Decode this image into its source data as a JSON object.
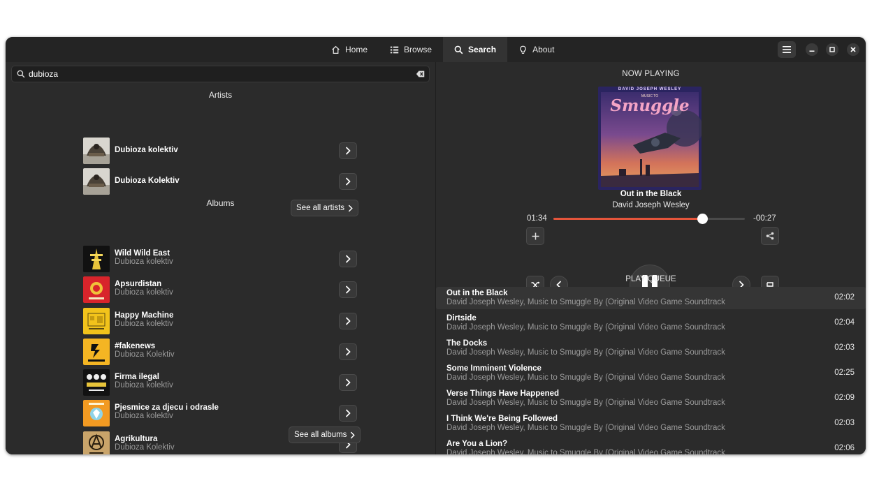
{
  "nav": {
    "tabs": [
      {
        "label": "Home",
        "icon": "home-icon"
      },
      {
        "label": "Browse",
        "icon": "list-icon"
      },
      {
        "label": "Search",
        "icon": "search-icon",
        "active": true
      },
      {
        "label": "About",
        "icon": "lightbulb-icon"
      }
    ]
  },
  "search": {
    "value": "dubioza"
  },
  "artists": {
    "heading": "Artists",
    "items": [
      {
        "name": "Dubioza kolektiv"
      },
      {
        "name": "Dubioza Kolektiv"
      }
    ],
    "see_all": "See all artists"
  },
  "albums": {
    "heading": "Albums",
    "items": [
      {
        "title": "Wild Wild East",
        "artist": "Dubioza kolektiv",
        "color": "#111111"
      },
      {
        "title": "Apsurdistan",
        "artist": "Dubioza kolektiv",
        "color": "#d8242b"
      },
      {
        "title": "Happy Machine",
        "artist": "Dubioza kolektiv",
        "color": "#f2c31b"
      },
      {
        "title": "#fakenews",
        "artist": "Dubioza Kolektiv",
        "color": "#f4b523"
      },
      {
        "title": "Firma ilegal",
        "artist": "Dubioza kolektiv",
        "color": "#121212"
      },
      {
        "title": "Pjesmice za djecu i odrasle",
        "artist": "Dubioza kolektiv",
        "color": "#f29a22"
      },
      {
        "title": "Agrikultura",
        "artist": "Dubioza Kolektiv",
        "color": "#c9a46a"
      }
    ],
    "see_all": "See all albums"
  },
  "now_playing": {
    "heading": "NOW PLAYING",
    "title": "Out in the Black",
    "artist": "David Joseph Wesley",
    "elapsed": "01:34",
    "remaining": "-00:27",
    "progress": 0.777,
    "cover_artist_text": "DAVID JOSEPH WESLEY",
    "cover_small_text": "MUSIC TO",
    "cover_title_text": "Smuggle"
  },
  "queue": {
    "heading": "PLAY QUEUE",
    "items": [
      {
        "title": "Out in the Black",
        "sub": "David Joseph Wesley, Music to Smuggle By (Original Video Game Soundtrack",
        "duration": "02:02",
        "current": true
      },
      {
        "title": "Dirtside",
        "sub": "David Joseph Wesley, Music to Smuggle By (Original Video Game Soundtrack",
        "duration": "02:04"
      },
      {
        "title": "The Docks",
        "sub": "David Joseph Wesley, Music to Smuggle By (Original Video Game Soundtrack",
        "duration": "02:03"
      },
      {
        "title": "Some Imminent Violence",
        "sub": "David Joseph Wesley, Music to Smuggle By (Original Video Game Soundtrack",
        "duration": "02:25"
      },
      {
        "title": "Verse Things Have Happened",
        "sub": "David Joseph Wesley, Music to Smuggle By (Original Video Game Soundtrack",
        "duration": "02:09"
      },
      {
        "title": "I Think We're Being Followed",
        "sub": "David Joseph Wesley, Music to Smuggle By (Original Video Game Soundtrack",
        "duration": "02:03"
      },
      {
        "title": "Are You a Lion?",
        "sub": "David Joseph Wesley, Music to Smuggle By (Original Video Game Soundtrack",
        "duration": "02:06"
      }
    ]
  },
  "colors": {
    "accent": "#e5553b",
    "window_bg": "#2b2b2b",
    "header_bg": "#242424"
  }
}
